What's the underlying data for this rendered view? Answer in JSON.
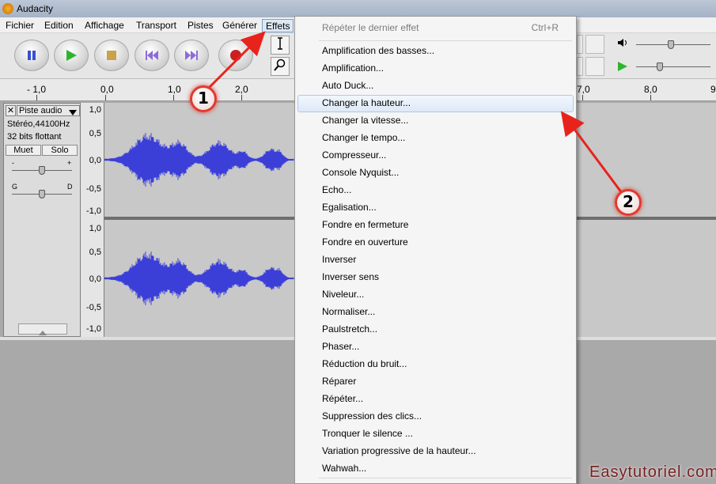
{
  "window": {
    "title": "Audacity"
  },
  "menubar": {
    "items": [
      "Fichier",
      "Edition",
      "Affichage",
      "Transport",
      "Pistes",
      "Générer",
      "Effets"
    ]
  },
  "ruler": {
    "labels": [
      "- 1,0",
      "0,0",
      "1,0",
      "2,0",
      "7,0",
      "8,0",
      "9"
    ]
  },
  "track": {
    "name": "Piste audio",
    "format": "Stéréo,44100Hz",
    "bits": "32 bits flottant",
    "mute_label": "Muet",
    "solo_label": "Solo",
    "gain_minus": "-",
    "gain_plus": "+",
    "pan_left": "G",
    "pan_right": "D",
    "gain_value": 0.5,
    "pan_value": 0.5,
    "scale": [
      "1,0",
      "0,5",
      "0,0",
      "-0,5",
      "-1,0"
    ]
  },
  "effects_menu": {
    "repeat_last": "Répéter le dernier effet",
    "repeat_shortcut": "Ctrl+R",
    "items": [
      "Amplification des basses...",
      "Amplification...",
      "Auto Duck...",
      "Changer la hauteur...",
      "Changer la vitesse...",
      "Changer le tempo...",
      "Compresseur...",
      "Console Nyquist...",
      "Echo...",
      "Egalisation...",
      "Fondre en fermeture",
      "Fondre en ouverture",
      "Inverser",
      "Inverser sens",
      "Niveleur...",
      "Normaliser...",
      "Paulstretch...",
      "Phaser...",
      "Réduction du bruit...",
      "Réparer",
      "Répéter...",
      "Suppression des clics...",
      "Tronquer le silence ...",
      "Variation progressive de la hauteur...",
      "Wahwah..."
    ],
    "highlighted": "Changer la hauteur..."
  },
  "annotations": {
    "step1": "1",
    "step2": "2"
  },
  "watermark": {
    "prefix": "Easytutoriel",
    "dot": ".",
    "suffix": "com"
  },
  "colors": {
    "waveform": "#3b3fd8",
    "arrow": "#e8231c",
    "highlight": "#dde9f7"
  },
  "icons": [
    "pause-icon",
    "play-icon",
    "stop-icon",
    "skip-start-icon",
    "skip-end-icon",
    "record-icon",
    "ibeam-cursor-icon",
    "zoom-icon",
    "speaker-icon",
    "small-play-icon"
  ]
}
